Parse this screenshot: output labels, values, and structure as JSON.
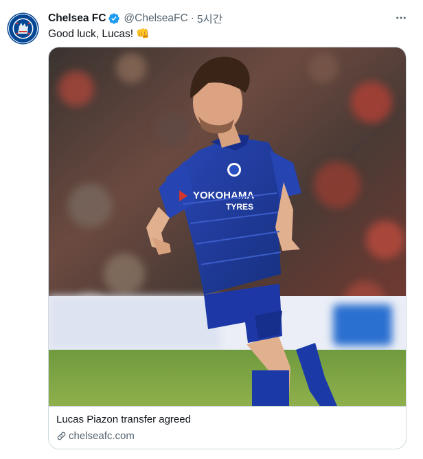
{
  "tweet": {
    "display_name": "Chelsea FC",
    "handle": "@ChelseaFC",
    "separator": "·",
    "time": "5시간",
    "text": "Good luck, Lucas! 👊",
    "verified_icon": "verified-badge-icon",
    "more_icon": "more-dots-icon",
    "more_label": "⋯"
  },
  "card": {
    "title": "Lucas Piazon transfer agreed",
    "domain": "chelseafc.com",
    "link_icon": "link-icon",
    "image_icon": "player-photo",
    "kit_sponsor": "YOKOHAMA",
    "kit_sponsor_sub": "TYRES"
  },
  "colors": {
    "verified": "#1d9bf0",
    "text_secondary": "#536471",
    "border": "#cfd9de",
    "chelsea_blue": "#034694"
  }
}
